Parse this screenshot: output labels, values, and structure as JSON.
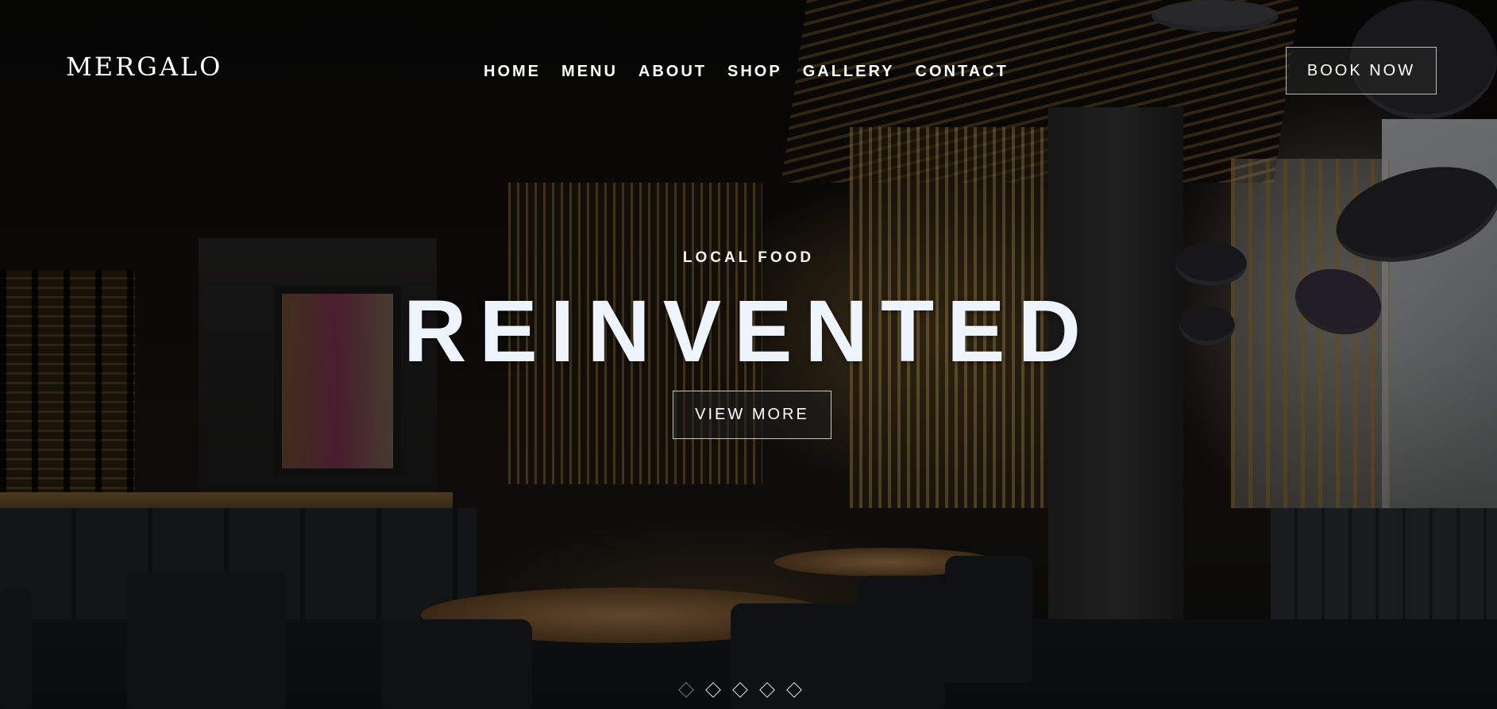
{
  "brand": {
    "logo_text": "MERGALO"
  },
  "nav": {
    "items": [
      {
        "label": "HOME"
      },
      {
        "label": "MENU"
      },
      {
        "label": "ABOUT"
      },
      {
        "label": "SHOP"
      },
      {
        "label": "GALLERY"
      },
      {
        "label": "CONTACT"
      }
    ]
  },
  "header": {
    "book_label": "BOOK NOW"
  },
  "hero": {
    "eyebrow": "LOCAL FOOD",
    "title": "REINVENTED",
    "cta_label": "VIEW MORE",
    "background": "restaurant-interior-photo"
  },
  "slider": {
    "slide_count": 5,
    "active_index": 1
  },
  "colors": {
    "text": "#ffffff",
    "title": "#eef4fb",
    "button_bg": "#282828",
    "overlay": "#000000"
  }
}
